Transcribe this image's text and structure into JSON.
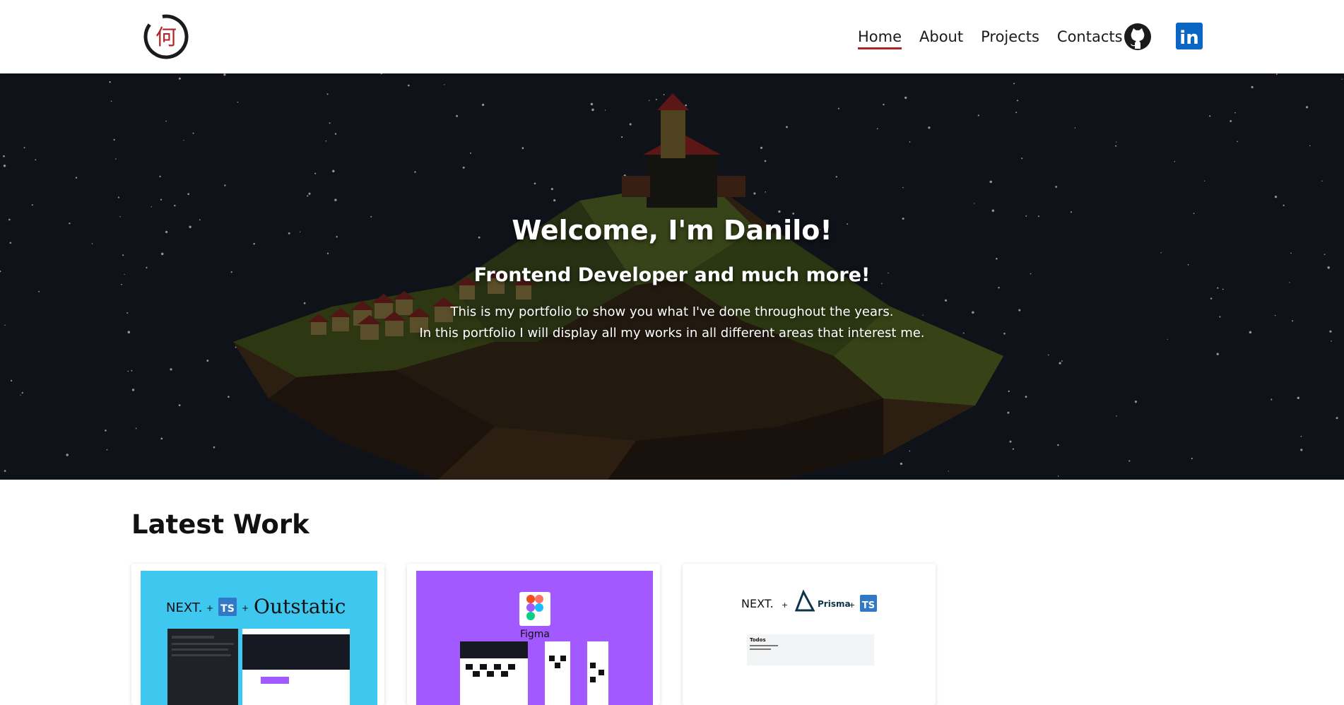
{
  "logo": {
    "glyph": "何",
    "alt": "logo"
  },
  "nav": {
    "links": [
      {
        "label": "Home",
        "active": true
      },
      {
        "label": "About",
        "active": false
      },
      {
        "label": "Projects",
        "active": false
      },
      {
        "label": "Contacts",
        "active": false
      }
    ],
    "social": [
      {
        "icon": "github-icon"
      },
      {
        "icon": "linkedin-icon",
        "label": "in"
      }
    ]
  },
  "hero": {
    "title": "Welcome, I'm Danilo!",
    "subtitle": "Frontend Developer and much more!",
    "line1": "This is my portfolio to show you what I've done throughout the years.",
    "line2": "In this portfolio I will display all my works in all different areas that interest me."
  },
  "latest": {
    "title": "Latest Work",
    "cards": [
      {
        "bg": "#3ec7ef",
        "logos": [
          "NEXT.",
          "TS",
          "Outstatic"
        ]
      },
      {
        "bg": "#a259ff",
        "logos": [
          "Figma"
        ]
      },
      {
        "bg": "#ffffff",
        "logos": [
          "NEXT.",
          "Prisma",
          "TS"
        ],
        "panel_title": "Todos"
      }
    ]
  },
  "colors": {
    "accent": "#b32323",
    "linkedin": "#0a66c2",
    "hero_bg": "#161922"
  }
}
